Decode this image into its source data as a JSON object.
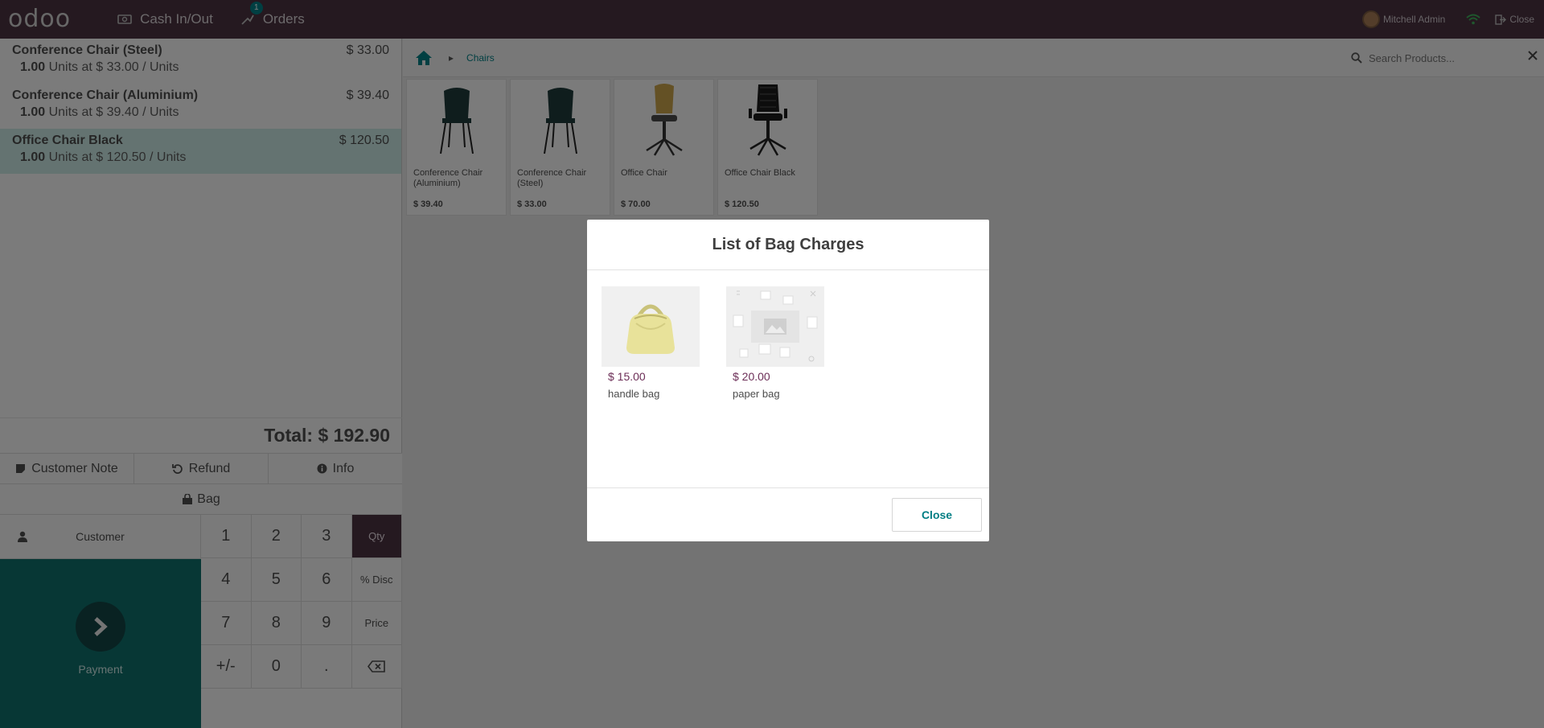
{
  "topbar": {
    "logo": "odoo",
    "cash_label": "Cash In/Out",
    "orders_label": "Orders",
    "orders_badge": "1",
    "user_name": "Mitchell Admin",
    "close_label": "Close"
  },
  "orderlines": [
    {
      "name": "Conference Chair (Steel)",
      "price": "$ 33.00",
      "qty": "1.00",
      "info": "Units at $ 33.00 / Units",
      "selected": false
    },
    {
      "name": "Conference Chair (Aluminium)",
      "price": "$ 39.40",
      "qty": "1.00",
      "info": "Units at $ 39.40 / Units",
      "selected": false
    },
    {
      "name": "Office Chair Black",
      "price": "$ 120.50",
      "qty": "1.00",
      "info": "Units at $ 120.50 / Units",
      "selected": true
    }
  ],
  "summary": {
    "total": "Total: $ 192.90"
  },
  "controls": {
    "customer_note": "Customer Note",
    "refund": "Refund",
    "info": "Info",
    "bag": "Bag",
    "customer": "Customer",
    "payment": "Payment"
  },
  "numpad": {
    "k1": "1",
    "k2": "2",
    "k3": "3",
    "qty": "Qty",
    "k4": "4",
    "k5": "5",
    "k6": "6",
    "disc": "% Disc",
    "k7": "7",
    "k8": "8",
    "k9": "9",
    "price": "Price",
    "plusminus": "+/-",
    "k0": "0",
    "dot": ".",
    "active_mode": "Qty"
  },
  "products_panel": {
    "breadcrumb": "Chairs",
    "search_placeholder": "Search Products...",
    "products": [
      {
        "name": "Conference Chair (Aluminium)",
        "price": "$ 39.40",
        "color": "#1f3b3a"
      },
      {
        "name": "Conference Chair (Steel)",
        "price": "$ 33.00",
        "color": "#1f3b3a"
      },
      {
        "name": "Office Chair",
        "price": "$ 70.00",
        "color": "#c8a24a"
      },
      {
        "name": "Office Chair Black",
        "price": "$ 120.50",
        "color": "#1a1a1a"
      }
    ]
  },
  "modal": {
    "title": "List of Bag Charges",
    "bags": [
      {
        "price": "$ 15.00",
        "name": "handle bag"
      },
      {
        "price": "$ 20.00",
        "name": "paper bag"
      }
    ],
    "close_label": "Close"
  },
  "colors": {
    "brand": "#4a3241",
    "teal": "#017e84",
    "payment_bg": "#0e6e6a",
    "selected_line": "#c9e7e3",
    "bag_price": "#6c2e57"
  }
}
